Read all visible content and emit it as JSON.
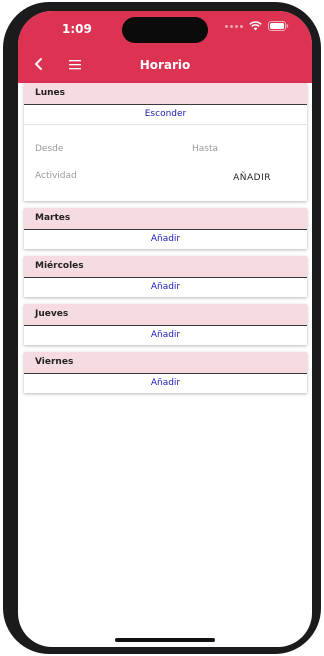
{
  "status_bar": {
    "time": "1:09"
  },
  "nav": {
    "title": "Horario",
    "back_icon": "chevron-left-icon",
    "menu_icon": "hamburger-menu-icon"
  },
  "colors": {
    "header": "#dc3352",
    "day_header": "#f6dbe1",
    "link": "#1c1cb0"
  },
  "days": [
    {
      "name": "Lunes",
      "link_label": "Esconder",
      "expanded": true,
      "form": {
        "desde_placeholder": "Desde",
        "hasta_placeholder": "Hasta",
        "actividad_placeholder": "Actividad",
        "add_button": "AÑADIR"
      }
    },
    {
      "name": "Martes",
      "link_label": "Añadir",
      "expanded": false
    },
    {
      "name": "Miércoles",
      "link_label": "Añadir",
      "expanded": false
    },
    {
      "name": "Jueves",
      "link_label": "Añadir",
      "expanded": false
    },
    {
      "name": "Viernes",
      "link_label": "Añadir",
      "expanded": false
    }
  ]
}
